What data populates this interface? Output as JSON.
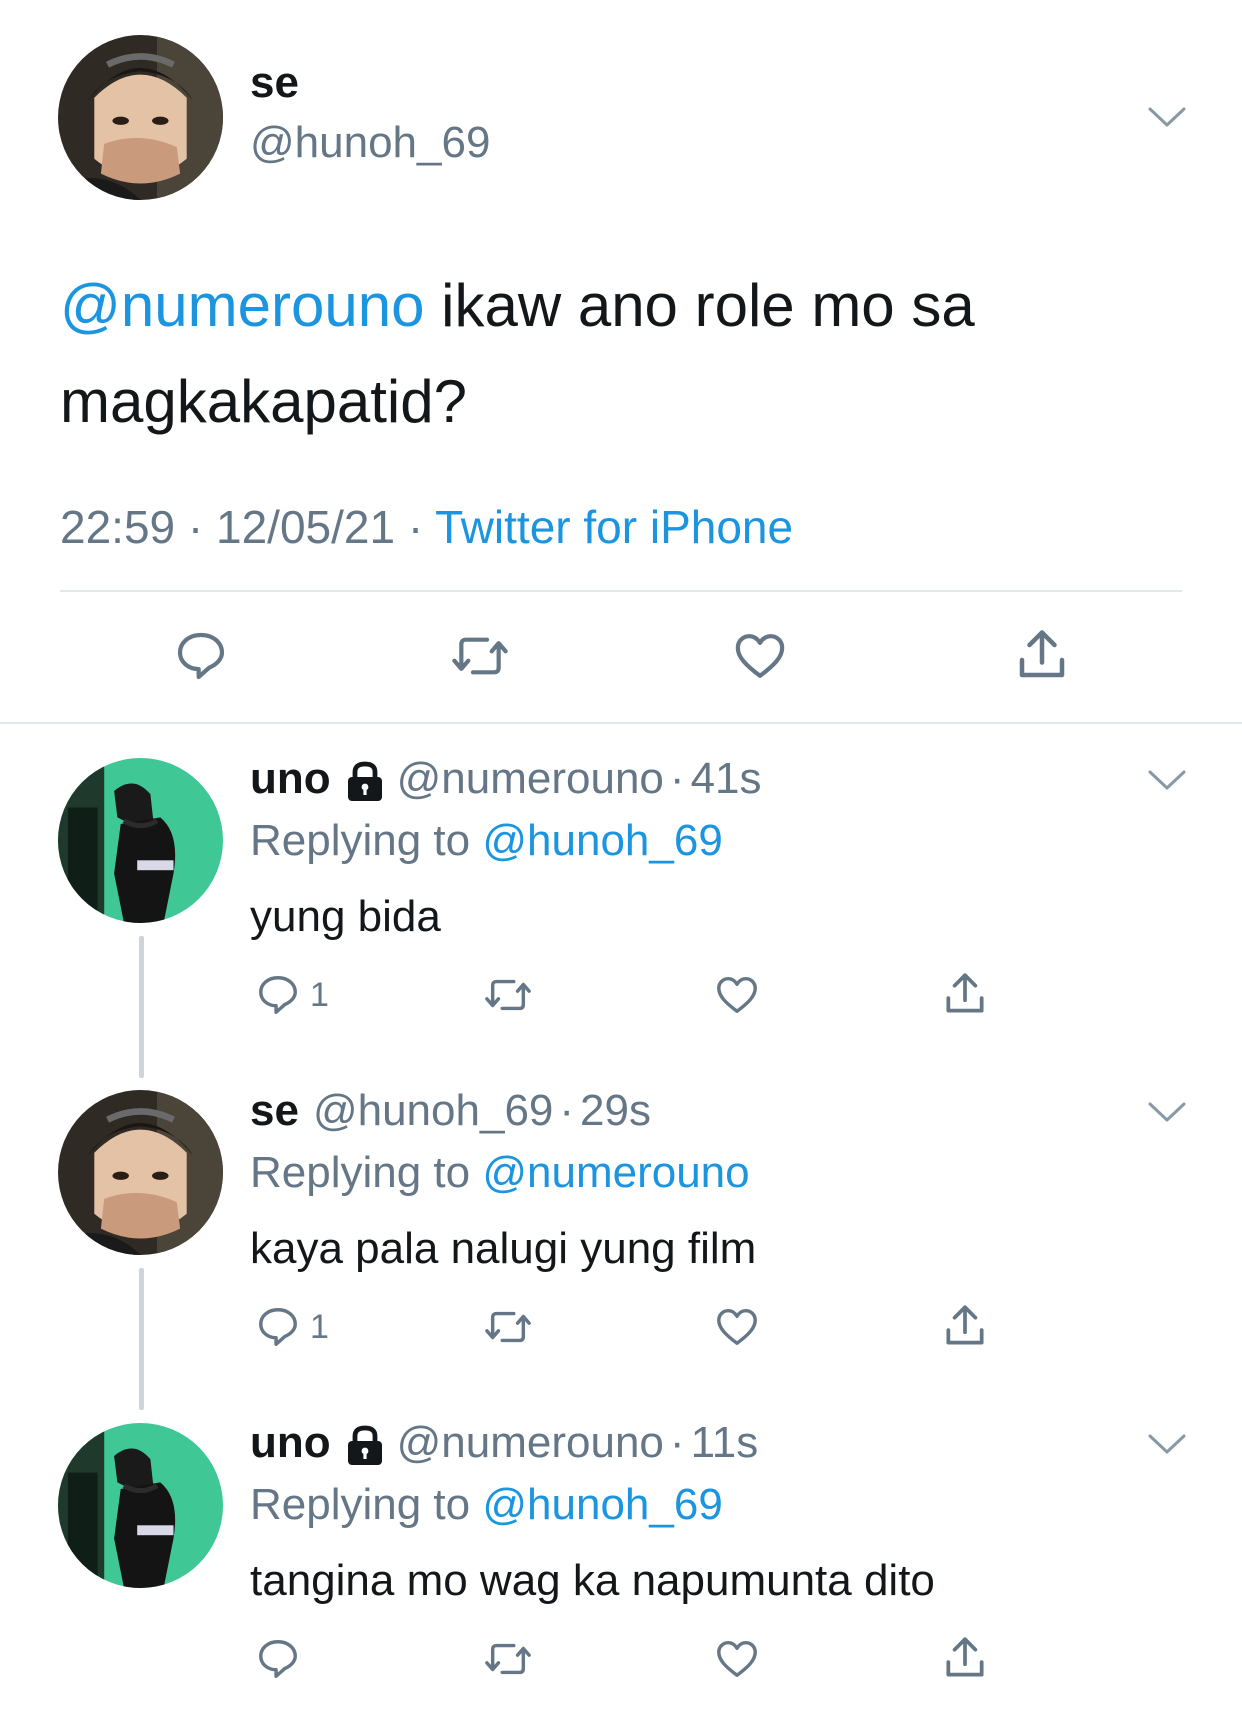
{
  "main_tweet": {
    "display_name": "se",
    "handle": "@hunoh_69",
    "mention": "@numerouno",
    "text": " ikaw ano role mo sa magkakapatid?",
    "time": "22:59",
    "date": "12/05/21",
    "source": "Twitter for iPhone",
    "sep": "·"
  },
  "replies": [
    {
      "display_name": "uno",
      "handle": "@numerouno",
      "age": "41s",
      "replying_label": "Replying to ",
      "replying_to": "@hunoh_69",
      "text": "yung bida",
      "reply_count": "1",
      "protected": true
    },
    {
      "display_name": "se",
      "handle": "@hunoh_69",
      "age": "29s",
      "replying_label": "Replying to ",
      "replying_to": "@numerouno",
      "text": "kaya pala nalugi yung film",
      "reply_count": "1",
      "protected": false
    },
    {
      "display_name": "uno",
      "handle": "@numerouno",
      "age": "11s",
      "replying_label": "Replying to ",
      "replying_to": "@hunoh_69",
      "text": "tangina mo wag ka napumunta dito",
      "reply_count": "",
      "protected": true
    }
  ],
  "icons": {
    "reply": "reply-icon",
    "retweet": "retweet-icon",
    "like": "heart-icon",
    "share": "share-icon",
    "more": "chevron-down-icon",
    "lock": "lock-icon"
  },
  "colors": {
    "link": "#1b95e0",
    "secondary": "#657786",
    "text": "#14171a",
    "divider": "#e1e8ed",
    "thread_line": "#cdd4da"
  }
}
